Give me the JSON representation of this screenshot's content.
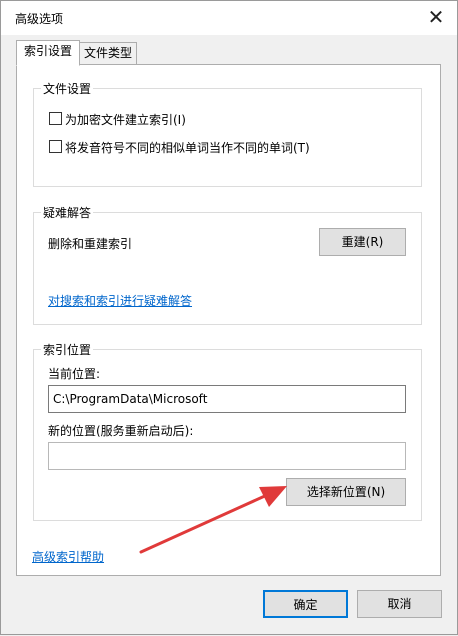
{
  "dialog": {
    "title": "高级选项"
  },
  "tabs": [
    {
      "label": "索引设置",
      "active": true
    },
    {
      "label": "文件类型",
      "active": false
    }
  ],
  "file_settings": {
    "title": "文件设置",
    "options": [
      {
        "label": "为加密文件建立索引(I)",
        "checked": false
      },
      {
        "label": "将发音符号不同的相似单词当作不同的单词(T)",
        "checked": false
      }
    ]
  },
  "troubleshoot": {
    "title": "疑难解答",
    "rebuild_text": "删除和重建索引",
    "rebuild_button": "重建(R)",
    "link": "对搜索和索引进行疑难解答"
  },
  "index_location": {
    "title": "索引位置",
    "current_label": "当前位置:",
    "current_value": "C:\\ProgramData\\Microsoft",
    "new_label": "新的位置(服务重新启动后):",
    "new_value": "",
    "select_button": "选择新位置(N)"
  },
  "footer": {
    "help_link": "高级索引帮助",
    "ok": "确定",
    "cancel": "取消"
  },
  "colors": {
    "arrow": "#e03a3a",
    "link": "#0066cc"
  }
}
